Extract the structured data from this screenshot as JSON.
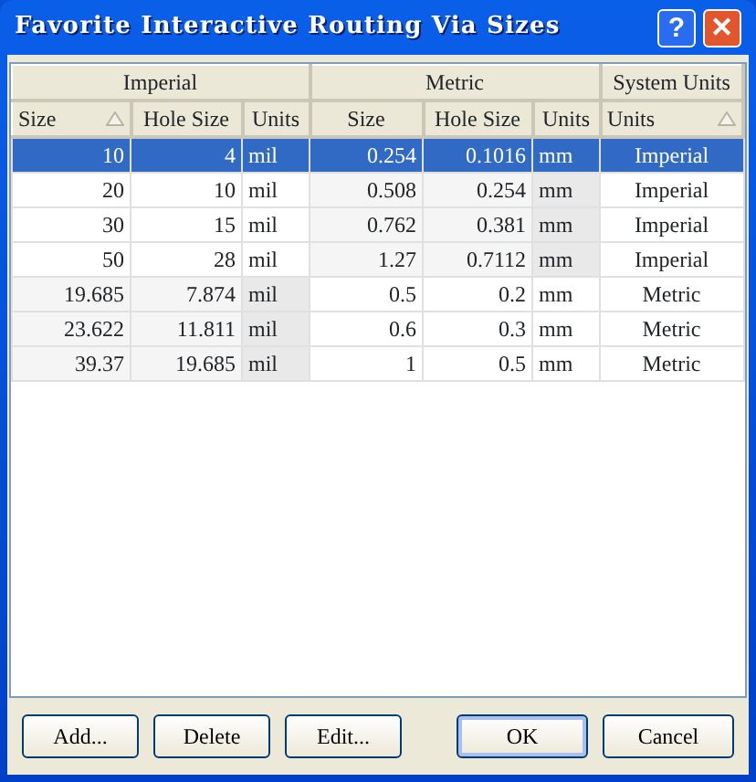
{
  "window": {
    "title": "Favorite Interactive Routing Via Sizes",
    "controls": [
      {
        "kind": "help",
        "label": "?"
      },
      {
        "kind": "close",
        "label": "✕"
      }
    ]
  },
  "groups": [
    {
      "label": "Imperial",
      "columns": [
        {
          "label": "Size",
          "sorted": true
        },
        {
          "label": "Hole Size",
          "sorted": false
        },
        {
          "label": "Units",
          "sorted": false
        }
      ]
    },
    {
      "label": "Metric",
      "columns": [
        {
          "label": "Size",
          "sorted": false
        },
        {
          "label": "Hole Size",
          "sorted": false
        },
        {
          "label": "Units",
          "sorted": false
        }
      ]
    },
    {
      "label": "System Units",
      "columns": [
        {
          "label": "Units",
          "sorted": true
        }
      ]
    }
  ],
  "rows": [
    {
      "kind": "imperial",
      "selected": true,
      "cells": [
        "10",
        "4",
        "mil",
        "0.254",
        "0.1016",
        "mm",
        "Imperial"
      ]
    },
    {
      "kind": "imperial",
      "selected": false,
      "cells": [
        "20",
        "10",
        "mil",
        "0.508",
        "0.254",
        "mm",
        "Imperial"
      ]
    },
    {
      "kind": "imperial",
      "selected": false,
      "cells": [
        "30",
        "15",
        "mil",
        "0.762",
        "0.381",
        "mm",
        "Imperial"
      ]
    },
    {
      "kind": "imperial",
      "selected": false,
      "cells": [
        "50",
        "28",
        "mil",
        "1.27",
        "0.7112",
        "mm",
        "Imperial"
      ]
    },
    {
      "kind": "metric",
      "selected": false,
      "cells": [
        "19.685",
        "7.874",
        "mil",
        "0.5",
        "0.2",
        "mm",
        "Metric"
      ]
    },
    {
      "kind": "metric",
      "selected": false,
      "cells": [
        "23.622",
        "11.811",
        "mil",
        "0.6",
        "0.3",
        "mm",
        "Metric"
      ]
    },
    {
      "kind": "metric",
      "selected": false,
      "cells": [
        "39.37",
        "19.685",
        "mil",
        "1",
        "0.5",
        "mm",
        "Metric"
      ]
    }
  ],
  "buttons": [
    {
      "label": "Add...",
      "default": false
    },
    {
      "label": "Delete",
      "default": false
    },
    {
      "label": "Edit...",
      "default": false
    },
    {
      "label": "OK",
      "default": true
    },
    {
      "label": "Cancel",
      "default": false
    }
  ]
}
